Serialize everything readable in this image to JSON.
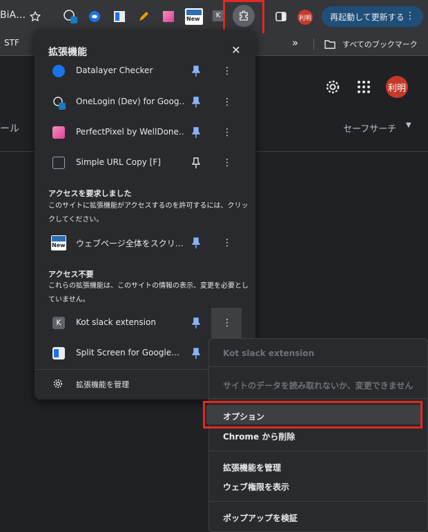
{
  "browser": {
    "tab_title": "BiA…",
    "relaunch_label": "再起動して更新する",
    "profile_badge": "利明",
    "new_badge": "New",
    "bookmarks_first": "STF",
    "all_bookmarks": "すべてのブックマーク",
    "more_bookmarks": "»"
  },
  "page": {
    "left_fragment": "ール",
    "safesearch": "セーフサーチ",
    "avatar": "利明"
  },
  "extensions_panel": {
    "title": "拡張機能",
    "pinned_items": [
      {
        "name": "Datalayer Checker",
        "icon_color": "#1a73e8",
        "pinned": true
      },
      {
        "name": "OneLogin (Dev) for Goog…",
        "icon_color": "#1a7bbf",
        "pinned": true
      },
      {
        "name": "PerfectPixel by WellDone…",
        "icon_color": "#e64a8a",
        "pinned": true
      },
      {
        "name": "Simple URL Copy [F]",
        "icon_color": "#9aa0a6",
        "pinned": false
      }
    ],
    "requested_section": {
      "heading": "アクセスを要求しました",
      "description": "このサイトに拡張機能がアクセスするのを許可するには、クリックしてください。",
      "items": [
        {
          "name": "ウェブページ全体をスクリ…",
          "badge": "New",
          "pinned": true
        }
      ]
    },
    "no_access_section": {
      "heading": "アクセス不要",
      "description": "これらの拡張機能は、このサイトの情報の表示、変更を必要としていません。",
      "items": [
        {
          "name": "Kot slack extension",
          "letter": "K",
          "pinned": true
        },
        {
          "name": "Split Screen for Google…",
          "pinned": true
        }
      ]
    },
    "manage_label": "拡張機能を管理"
  },
  "context_menu": {
    "ext_name": "Kot slack extension",
    "cannot_read": "サイトのデータを読み取れないか、変更できません",
    "options": "オプション",
    "remove": "Chrome から削除",
    "manage": "拡張機能を管理",
    "web_permissions": "ウェブ権限を表示",
    "inspect_popup": "ポップアップを検証"
  },
  "colors": {
    "highlight": "#e3291f",
    "pin_blue": "#8ab4f8",
    "relaunch_bg": "#1f4e79"
  }
}
